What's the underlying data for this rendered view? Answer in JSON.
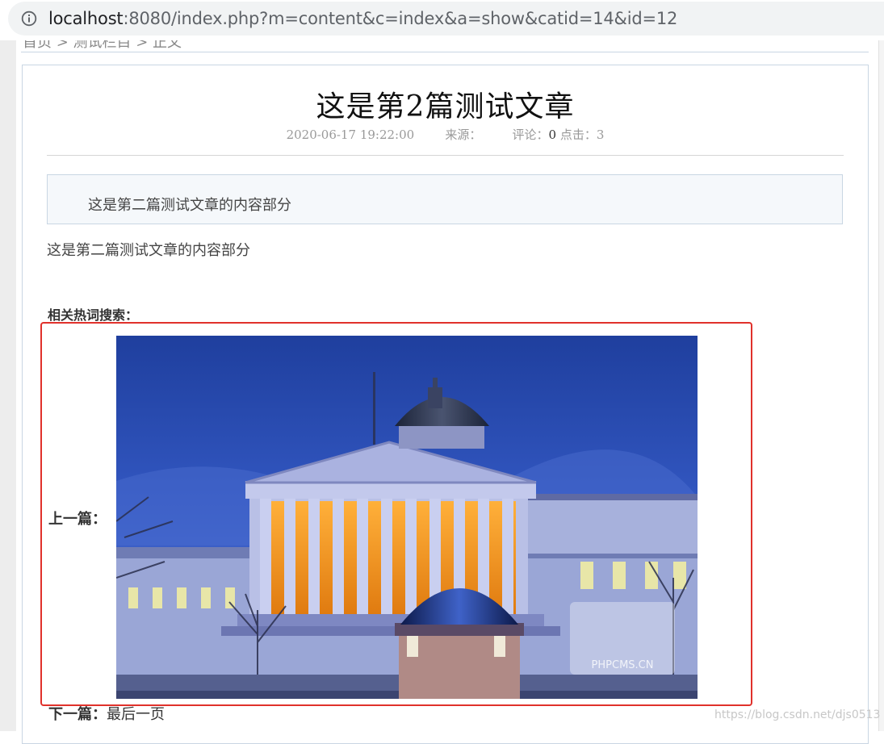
{
  "browser": {
    "url_host": "localhost",
    "url_rest": ":8080/index.php?m=content&c=index&a=show&catid=14&id=12"
  },
  "breadcrumb": {
    "text": "首页 > 测试栏目 > 正文"
  },
  "article": {
    "title": "这是第2篇测试文章",
    "date": "2020-06-17 19:22:00",
    "source_label": "来源：",
    "comment_label": "评论：",
    "comment_count": "0",
    "click_label": "点击：",
    "click_count": "3",
    "summary": "这是第二篇测试文章的内容部分",
    "body": "这是第二篇测试文章的内容部分",
    "hot_search_label": "相关热词搜索：",
    "prev_label": "上一篇：",
    "next_label": "下一篇：",
    "next_value": "最后一页"
  },
  "watermark": "https://blog.csdn.net/djs0513",
  "image": {
    "watermark_text": "PHPCMS.CN"
  },
  "colors": {
    "highlight_border": "#e0312b",
    "panel_border": "#c9d6e3"
  }
}
